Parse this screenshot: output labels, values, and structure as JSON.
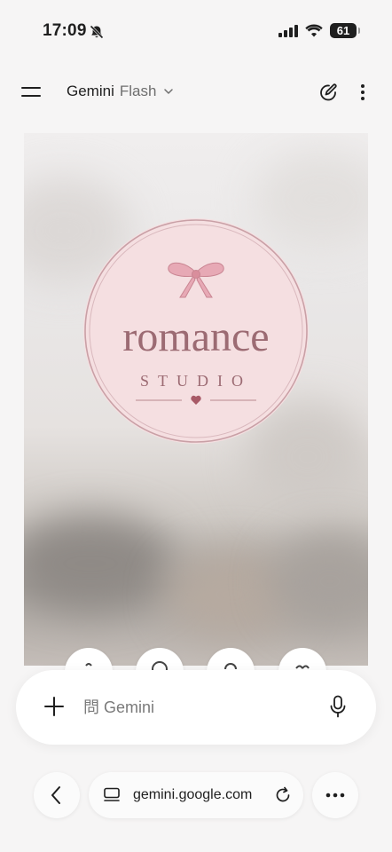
{
  "status_bar": {
    "time": "17:09",
    "battery": "61"
  },
  "header": {
    "title": "Gemini",
    "model": "Flash"
  },
  "image": {
    "logo_main": "romance",
    "logo_sub": "STUDIO",
    "colors": {
      "circle": "#f5dfe1",
      "ring": "#c9a0a6",
      "text": "#9c6b73",
      "bow": "#e7a9b5",
      "heart": "#a85a67"
    }
  },
  "prompt": {
    "placeholder": "問 Gemini"
  },
  "browser": {
    "url": "gemini.google.com"
  }
}
